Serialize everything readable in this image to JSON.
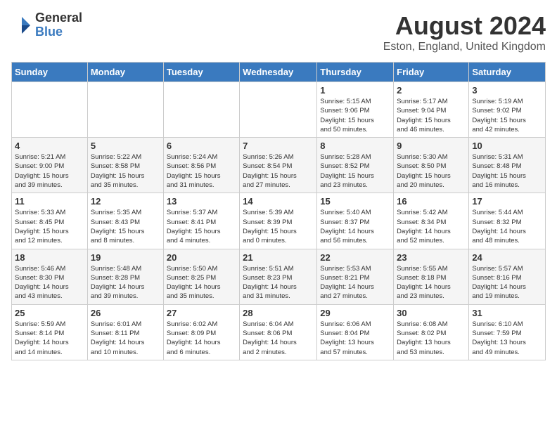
{
  "logo": {
    "general": "General",
    "blue": "Blue"
  },
  "title": "August 2024",
  "location": "Eston, England, United Kingdom",
  "days_of_week": [
    "Sunday",
    "Monday",
    "Tuesday",
    "Wednesday",
    "Thursday",
    "Friday",
    "Saturday"
  ],
  "weeks": [
    [
      {
        "day": "",
        "info": ""
      },
      {
        "day": "",
        "info": ""
      },
      {
        "day": "",
        "info": ""
      },
      {
        "day": "",
        "info": ""
      },
      {
        "day": "1",
        "info": "Sunrise: 5:15 AM\nSunset: 9:06 PM\nDaylight: 15 hours\nand 50 minutes."
      },
      {
        "day": "2",
        "info": "Sunrise: 5:17 AM\nSunset: 9:04 PM\nDaylight: 15 hours\nand 46 minutes."
      },
      {
        "day": "3",
        "info": "Sunrise: 5:19 AM\nSunset: 9:02 PM\nDaylight: 15 hours\nand 42 minutes."
      }
    ],
    [
      {
        "day": "4",
        "info": "Sunrise: 5:21 AM\nSunset: 9:00 PM\nDaylight: 15 hours\nand 39 minutes."
      },
      {
        "day": "5",
        "info": "Sunrise: 5:22 AM\nSunset: 8:58 PM\nDaylight: 15 hours\nand 35 minutes."
      },
      {
        "day": "6",
        "info": "Sunrise: 5:24 AM\nSunset: 8:56 PM\nDaylight: 15 hours\nand 31 minutes."
      },
      {
        "day": "7",
        "info": "Sunrise: 5:26 AM\nSunset: 8:54 PM\nDaylight: 15 hours\nand 27 minutes."
      },
      {
        "day": "8",
        "info": "Sunrise: 5:28 AM\nSunset: 8:52 PM\nDaylight: 15 hours\nand 23 minutes."
      },
      {
        "day": "9",
        "info": "Sunrise: 5:30 AM\nSunset: 8:50 PM\nDaylight: 15 hours\nand 20 minutes."
      },
      {
        "day": "10",
        "info": "Sunrise: 5:31 AM\nSunset: 8:48 PM\nDaylight: 15 hours\nand 16 minutes."
      }
    ],
    [
      {
        "day": "11",
        "info": "Sunrise: 5:33 AM\nSunset: 8:45 PM\nDaylight: 15 hours\nand 12 minutes."
      },
      {
        "day": "12",
        "info": "Sunrise: 5:35 AM\nSunset: 8:43 PM\nDaylight: 15 hours\nand 8 minutes."
      },
      {
        "day": "13",
        "info": "Sunrise: 5:37 AM\nSunset: 8:41 PM\nDaylight: 15 hours\nand 4 minutes."
      },
      {
        "day": "14",
        "info": "Sunrise: 5:39 AM\nSunset: 8:39 PM\nDaylight: 15 hours\nand 0 minutes."
      },
      {
        "day": "15",
        "info": "Sunrise: 5:40 AM\nSunset: 8:37 PM\nDaylight: 14 hours\nand 56 minutes."
      },
      {
        "day": "16",
        "info": "Sunrise: 5:42 AM\nSunset: 8:34 PM\nDaylight: 14 hours\nand 52 minutes."
      },
      {
        "day": "17",
        "info": "Sunrise: 5:44 AM\nSunset: 8:32 PM\nDaylight: 14 hours\nand 48 minutes."
      }
    ],
    [
      {
        "day": "18",
        "info": "Sunrise: 5:46 AM\nSunset: 8:30 PM\nDaylight: 14 hours\nand 43 minutes."
      },
      {
        "day": "19",
        "info": "Sunrise: 5:48 AM\nSunset: 8:28 PM\nDaylight: 14 hours\nand 39 minutes."
      },
      {
        "day": "20",
        "info": "Sunrise: 5:50 AM\nSunset: 8:25 PM\nDaylight: 14 hours\nand 35 minutes."
      },
      {
        "day": "21",
        "info": "Sunrise: 5:51 AM\nSunset: 8:23 PM\nDaylight: 14 hours\nand 31 minutes."
      },
      {
        "day": "22",
        "info": "Sunrise: 5:53 AM\nSunset: 8:21 PM\nDaylight: 14 hours\nand 27 minutes."
      },
      {
        "day": "23",
        "info": "Sunrise: 5:55 AM\nSunset: 8:18 PM\nDaylight: 14 hours\nand 23 minutes."
      },
      {
        "day": "24",
        "info": "Sunrise: 5:57 AM\nSunset: 8:16 PM\nDaylight: 14 hours\nand 19 minutes."
      }
    ],
    [
      {
        "day": "25",
        "info": "Sunrise: 5:59 AM\nSunset: 8:14 PM\nDaylight: 14 hours\nand 14 minutes."
      },
      {
        "day": "26",
        "info": "Sunrise: 6:01 AM\nSunset: 8:11 PM\nDaylight: 14 hours\nand 10 minutes."
      },
      {
        "day": "27",
        "info": "Sunrise: 6:02 AM\nSunset: 8:09 PM\nDaylight: 14 hours\nand 6 minutes."
      },
      {
        "day": "28",
        "info": "Sunrise: 6:04 AM\nSunset: 8:06 PM\nDaylight: 14 hours\nand 2 minutes."
      },
      {
        "day": "29",
        "info": "Sunrise: 6:06 AM\nSunset: 8:04 PM\nDaylight: 13 hours\nand 57 minutes."
      },
      {
        "day": "30",
        "info": "Sunrise: 6:08 AM\nSunset: 8:02 PM\nDaylight: 13 hours\nand 53 minutes."
      },
      {
        "day": "31",
        "info": "Sunrise: 6:10 AM\nSunset: 7:59 PM\nDaylight: 13 hours\nand 49 minutes."
      }
    ]
  ]
}
